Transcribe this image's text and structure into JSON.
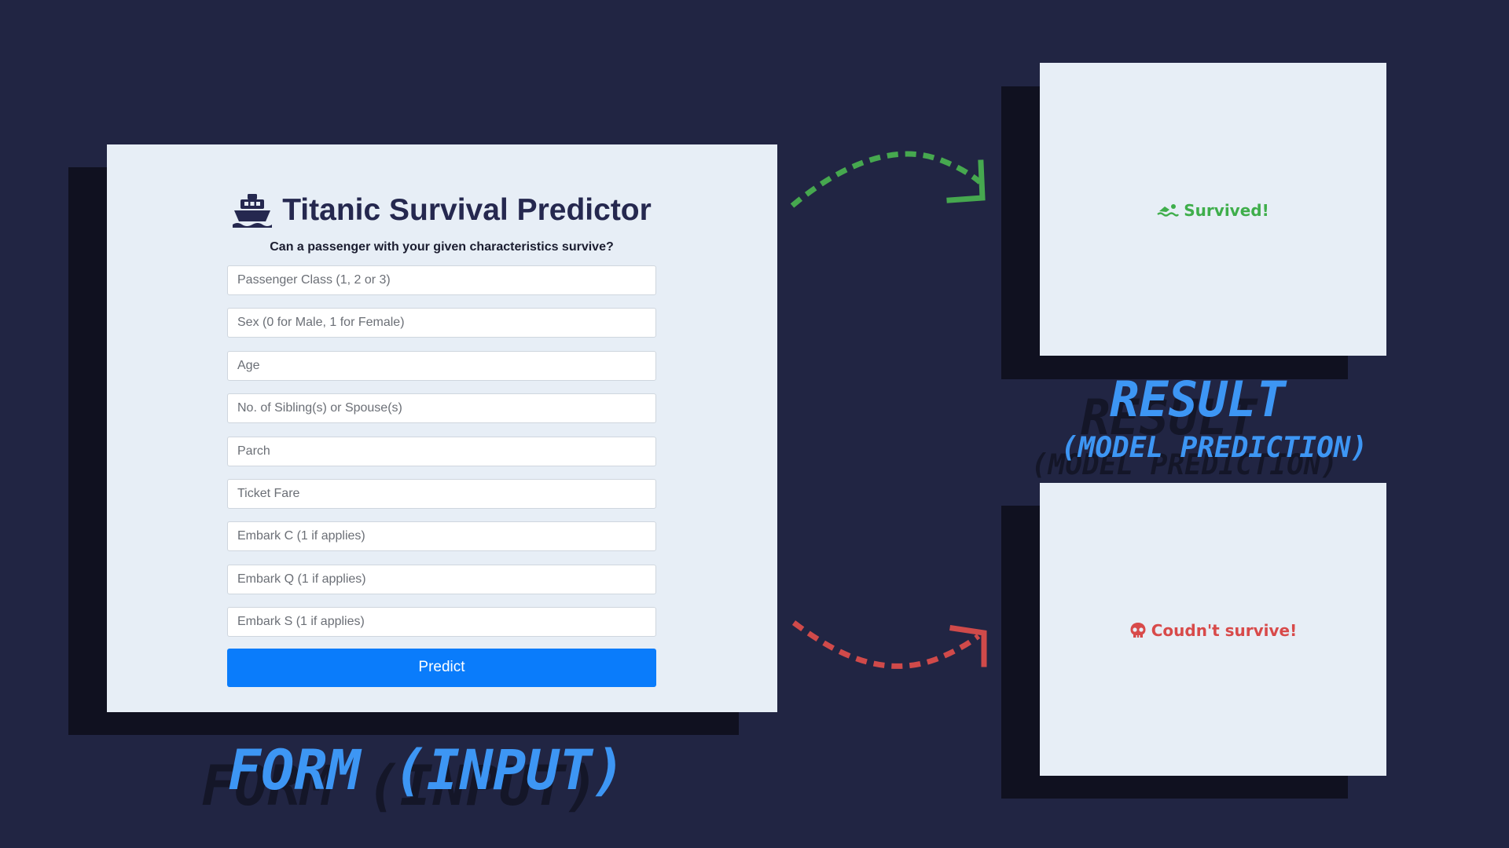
{
  "form": {
    "title": "Titanic Survival Predictor",
    "title_icon": "ship-icon",
    "subtitle": "Can a passenger with your given characteristics survive?",
    "fields": [
      {
        "placeholder": "Passenger Class (1, 2 or 3)"
      },
      {
        "placeholder": "Sex (0 for Male, 1 for Female)"
      },
      {
        "placeholder": "Age"
      },
      {
        "placeholder": "No. of Sibling(s) or Spouse(s)"
      },
      {
        "placeholder": "Parch"
      },
      {
        "placeholder": "Ticket Fare"
      },
      {
        "placeholder": "Embark C (1 if applies)"
      },
      {
        "placeholder": "Embark Q (1 if applies)"
      },
      {
        "placeholder": "Embark S (1 if applies)"
      }
    ],
    "predict_label": "Predict"
  },
  "results": {
    "survived": {
      "text": "Survived!",
      "icon": "swimmer-icon",
      "color": "#3fae4b"
    },
    "not_survived": {
      "text": "Coudn't survive!",
      "icon": "skull-icon",
      "color": "#d84a4a"
    }
  },
  "labels": {
    "form": "FORM (INPUT)",
    "result": "RESULT",
    "prediction": "(MODEL PREDICTION)"
  },
  "colors": {
    "background": "#212543",
    "panel": "#e7eef6",
    "accent": "#0a7cfb",
    "label": "#3d96f4"
  }
}
